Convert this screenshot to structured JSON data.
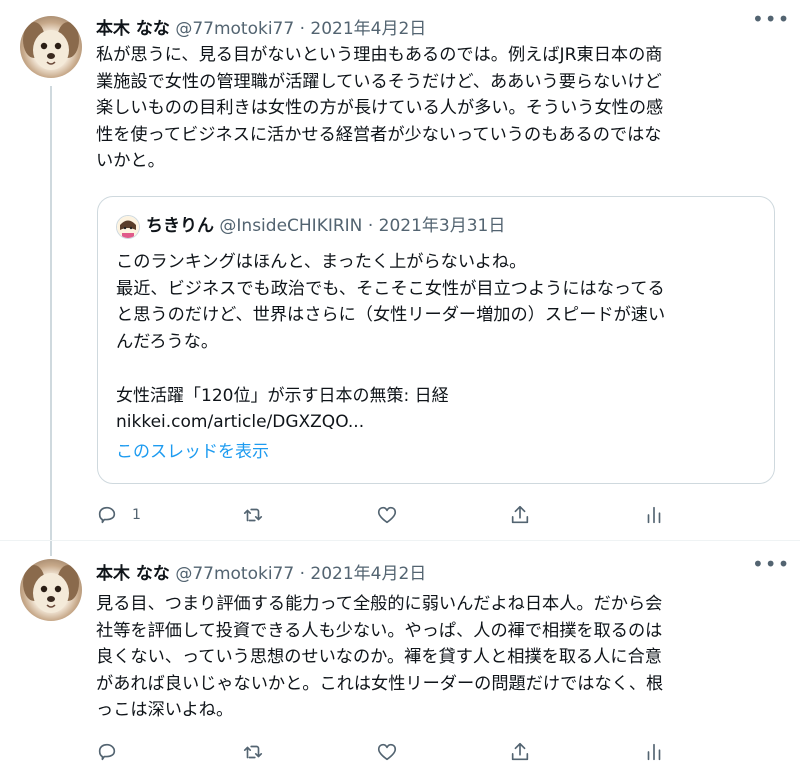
{
  "tweets": [
    {
      "author_name": "本木 なな",
      "handle": "@77motoki77",
      "separator": "·",
      "date": "2021年4月2日",
      "more_label": "•••",
      "text": "私が思うに、見る目がないという理由もあるのでは。例えばJR東日本の商\n業施設で女性の管理職が活躍しているそうだけど、ああいう要らないけど\n楽しいものの目利きは女性の方が長けている人が多い。そういう女性の感\n性を使ってビジネスに活かせる経営者が少ないっていうのもあるのではな\nいかと。",
      "quote": {
        "author_name": "ちきりん",
        "handle": "@InsideCHIKIRIN",
        "separator": "·",
        "date": "2021年3月31日",
        "text": "このランキングはほんと、まったく上がらないよね。\n最近、ビジネスでも政治でも、そこそこ女性が目立つようにはなってる\nと思うのだけど、世界はさらに（女性リーダー増加の）スピードが速い\nんだろうな。",
        "link_title": "女性活躍「120位」が示す日本の無策: 日経",
        "link_url": "nikkei.com/article/DGXZQO...",
        "show_thread": "このスレッドを表示"
      },
      "reply_count": "1",
      "retweet_count": "",
      "like_count": ""
    },
    {
      "author_name": "本木 なな",
      "handle": "@77motoki77",
      "separator": "·",
      "date": "2021年4月2日",
      "more_label": "•••",
      "text": "見る目、つまり評価する能力って全般的に弱いんだよね日本人。だから会\n社等を評価して投資できる人も少ない。やっぱ、人の褌で相撲を取るのは\n良くない、っていう思想のせいなのか。褌を貸す人と相撲を取る人に合意\nがあれば良いじゃないかと。これは女性リーダーの問題だけではなく、根\nっこは深いよね。",
      "reply_count": "",
      "retweet_count": "",
      "like_count": ""
    }
  ],
  "icons": {
    "reply": "reply-icon",
    "retweet": "retweet-icon",
    "like": "like-icon",
    "share": "share-icon",
    "analytics": "analytics-icon"
  },
  "colors": {
    "text": "#0f1419",
    "secondary": "#536471",
    "link": "#1d9bf0",
    "border": "#cfd9de"
  }
}
